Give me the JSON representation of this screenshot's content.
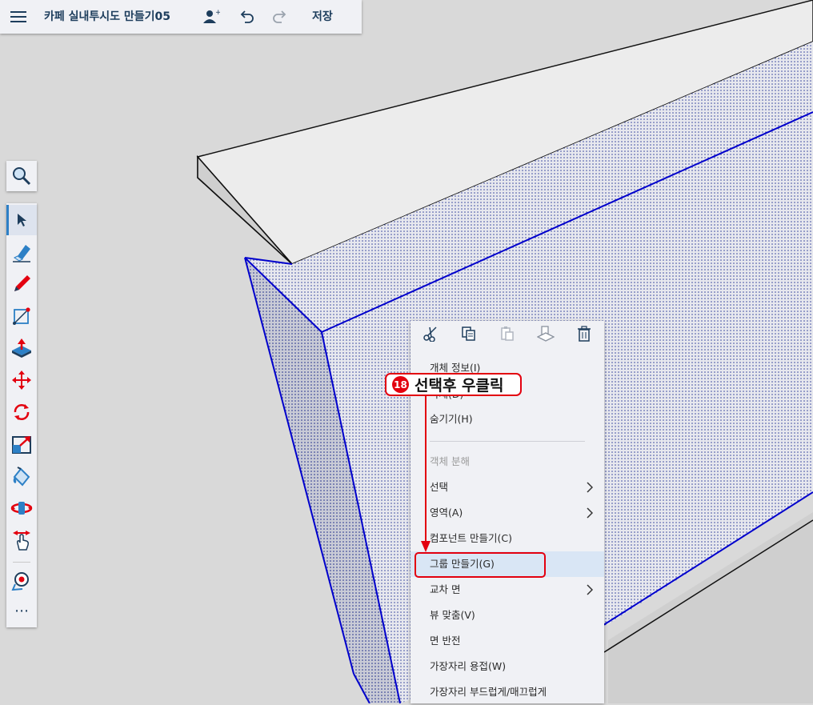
{
  "topbar": {
    "title": "카페 실내투시도 만들기05",
    "save_label": "저장",
    "icons": [
      "menu-icon",
      "add-user-icon",
      "undo-icon",
      "redo-icon"
    ]
  },
  "toolbar": {
    "tools": [
      "search-icon",
      "select-icon",
      "eraser-icon",
      "pencil-icon",
      "rectangle-icon",
      "push-pull-icon",
      "move-icon",
      "rotate-icon",
      "scale-icon",
      "paint-bucket-icon",
      "orbit-icon",
      "pan-icon",
      "tape-measure-icon",
      "more-icon"
    ],
    "active": "select-icon",
    "more_label": "⋯"
  },
  "context_menu": {
    "icons": [
      "cut-icon",
      "copy-icon",
      "paste-icon",
      "paste-in-place-icon",
      "delete-icon"
    ],
    "items": [
      {
        "label": "개체 정보(I)",
        "enabled": true
      },
      {
        "label": "삭제(D)",
        "enabled": true
      },
      {
        "label": "숨기기(H)",
        "enabled": true
      },
      {
        "label": "객체 분해",
        "enabled": false
      },
      {
        "label": "선택",
        "enabled": true,
        "submenu": true
      },
      {
        "label": "영역(A)",
        "enabled": true,
        "submenu": true
      },
      {
        "label": "컴포넌트 만들기(C)",
        "enabled": true
      },
      {
        "label": "그룹 만들기(G)",
        "enabled": true,
        "highlighted": true
      },
      {
        "label": "교차 면",
        "enabled": true,
        "submenu": true
      },
      {
        "label": "뷰 맞춤(V)",
        "enabled": true
      },
      {
        "label": "면 반전",
        "enabled": true
      },
      {
        "label": "가장자리 용접(W)",
        "enabled": true
      },
      {
        "label": "가장자리 부드럽게/매끄럽게",
        "enabled": true
      }
    ]
  },
  "annotation": {
    "number": "18",
    "text": "선택후 우클릭",
    "color": "#e3000f"
  },
  "colors": {
    "selection": "#0000cc",
    "accent": "#2d80c6",
    "title": "#1d3d5c"
  }
}
